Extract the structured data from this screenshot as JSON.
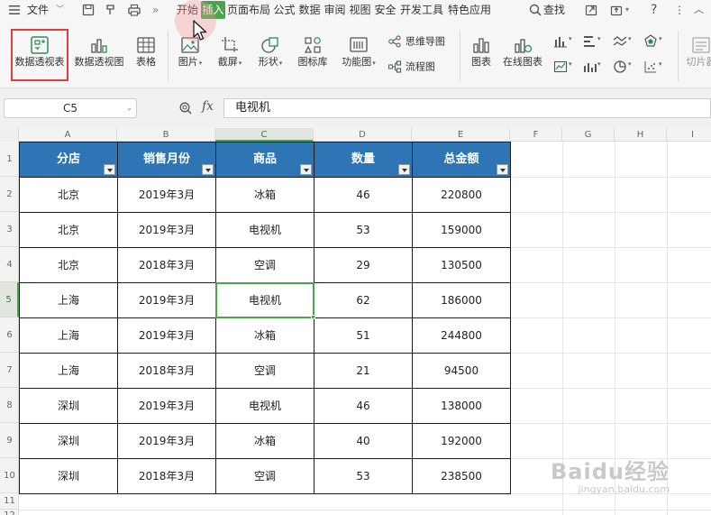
{
  "menubar": {
    "file_label": "文件",
    "tabs": [
      "开始",
      "插入",
      "页面布局",
      "公式",
      "数据",
      "审阅",
      "视图",
      "安全",
      "开发工具",
      "特色应用"
    ],
    "active_tab": "插入",
    "search_label": "查找"
  },
  "ribbon": {
    "buttons": [
      {
        "label": "数据透视表",
        "icon": "pivot-table-icon"
      },
      {
        "label": "数据透视图",
        "icon": "pivot-chart-icon"
      },
      {
        "label": "表格",
        "icon": "table-icon"
      },
      {
        "label": "图片",
        "icon": "picture-icon"
      },
      {
        "label": "截屏",
        "icon": "screenshot-icon"
      },
      {
        "label": "形状",
        "icon": "shape-icon"
      },
      {
        "label": "图标库",
        "icon": "icon-library-icon"
      },
      {
        "label": "功能图",
        "icon": "function-chart-icon"
      },
      {
        "label": "思维导图",
        "icon": "mindmap-icon"
      },
      {
        "label": "流程图",
        "icon": "flowchart-icon"
      },
      {
        "label": "图表",
        "icon": "chart-icon"
      },
      {
        "label": "在线图表",
        "icon": "online-chart-icon"
      },
      {
        "label": "切片器",
        "icon": "slicer-icon"
      }
    ]
  },
  "formula_bar": {
    "name_box": "C5",
    "fx": "fx",
    "formula": "电视机"
  },
  "sheet": {
    "column_headers": [
      "A",
      "B",
      "C",
      "D",
      "E",
      "F",
      "G",
      "H",
      "I"
    ],
    "row_numbers": [
      "1",
      "2",
      "3",
      "4",
      "5",
      "6",
      "7",
      "8",
      "9",
      "10",
      "11",
      "12"
    ],
    "active_column": "C",
    "active_row": "5",
    "table_headers": [
      "分店",
      "销售月份",
      "商品",
      "数量",
      "总金额"
    ],
    "rows": [
      [
        "北京",
        "2019年3月",
        "冰箱",
        "46",
        "220800"
      ],
      [
        "北京",
        "2019年3月",
        "电视机",
        "53",
        "159000"
      ],
      [
        "北京",
        "2018年3月",
        "空调",
        "29",
        "130500"
      ],
      [
        "上海",
        "2019年3月",
        "电视机",
        "62",
        "186000"
      ],
      [
        "上海",
        "2019年3月",
        "冰箱",
        "51",
        "244800"
      ],
      [
        "上海",
        "2018年3月",
        "空调",
        "21",
        "94500"
      ],
      [
        "深圳",
        "2019年3月",
        "电视机",
        "46",
        "138000"
      ],
      [
        "深圳",
        "2019年3月",
        "冰箱",
        "40",
        "192000"
      ],
      [
        "深圳",
        "2018年3月",
        "空调",
        "53",
        "238500"
      ]
    ]
  },
  "colors": {
    "header_fill": "#2e75b6",
    "active_tab": "#4ca34d",
    "highlight_box": "#e23c3c"
  },
  "watermark": {
    "top": "Baidu经验",
    "bottom": "jingyan.baidu.com"
  }
}
